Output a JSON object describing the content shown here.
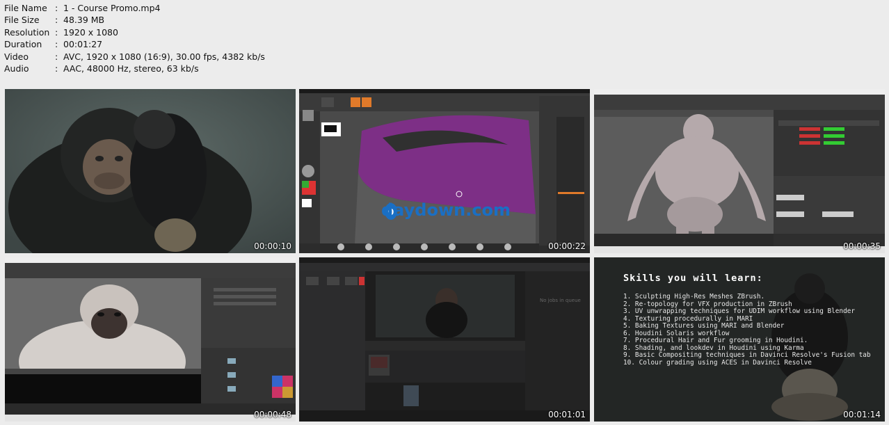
{
  "info": [
    {
      "key": "File Name",
      "value": "1 - Course Promo.mp4"
    },
    {
      "key": "File Size",
      "value": "48.39 MB"
    },
    {
      "key": "Resolution",
      "value": "1920 x 1080"
    },
    {
      "key": "Duration",
      "value": "00:01:27"
    },
    {
      "key": "Video",
      "value": "AVC, 1920 x 1080 (16:9), 30.00 fps, 4382 kb/s"
    },
    {
      "key": "Audio",
      "value": "AAC, 48000 Hz, stereo, 63 kb/s"
    }
  ],
  "separator": ":",
  "thumbs": [
    {
      "time": "00:00:10"
    },
    {
      "time": "00:00:22",
      "watermark": "daydown.com"
    },
    {
      "time": "00:00:35"
    },
    {
      "time": "00:00:48"
    },
    {
      "time": "00:01:01",
      "queue_text": "No jobs in queue"
    },
    {
      "time": "00:01:14"
    }
  ],
  "skills": {
    "title": "Skills you will learn:",
    "items": [
      "1. Sculpting High-Res Meshes ZBrush.",
      "2. Re-topology for VFX production in ZBrush",
      "3. UV unwrapping techniques for UDIM workflow using Blender",
      "4. Texturing procedurally in MARI",
      "5. Baking Textures using MARI and Blender",
      "6. Houdini Solaris workflow",
      "7. Procedural Hair and Fur grooming in Houdini.",
      "8. Shading, and lookdev in Houdini using Karma",
      "9. Basic Compositing techniques in Davinci Resolve's Fusion tab",
      "10. Colour grading using ACES in Davinci Resolve"
    ]
  }
}
